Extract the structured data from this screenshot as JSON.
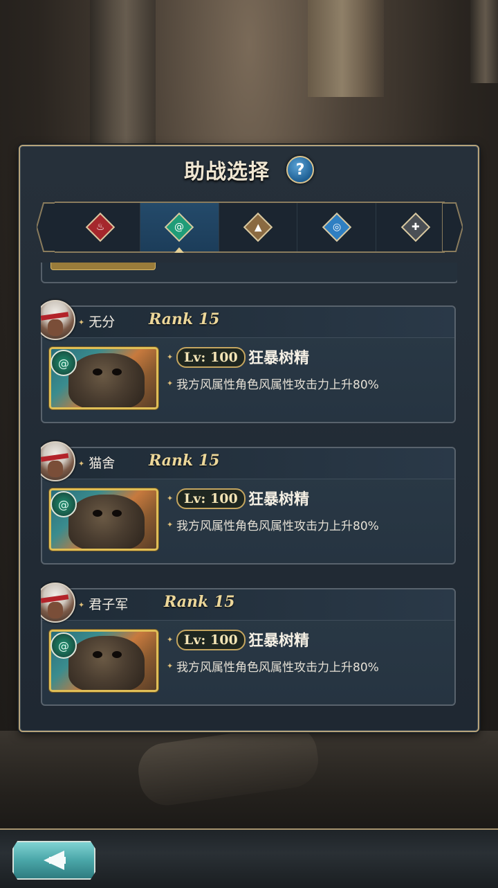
{
  "dialog": {
    "title": "助战选择",
    "help_label": "?"
  },
  "tabs": [
    {
      "icon": "fire-element-icon",
      "active": false
    },
    {
      "icon": "wind-element-icon",
      "active": true
    },
    {
      "icon": "earth-element-icon",
      "active": false
    },
    {
      "icon": "water-element-icon",
      "active": false
    },
    {
      "icon": "neutral-element-icon",
      "active": false
    }
  ],
  "supporters": [
    {
      "name": "无分",
      "rank": "Rank 15",
      "level": "Lv: 100",
      "monster": "狂暴树精",
      "effect": "我方风属性角色风属性攻击力上升80%"
    },
    {
      "name": "猫舍",
      "rank": "Rank 15",
      "level": "Lv: 100",
      "monster": "狂暴树精",
      "effect": "我方风属性角色风属性攻击力上升80%"
    },
    {
      "name": "君子军",
      "rank": "Rank 15",
      "level": "Lv: 100",
      "monster": "狂暴树精",
      "effect": "我方风属性角色风属性攻击力上升80%"
    }
  ],
  "colors": {
    "panel_border": "#b7a37a",
    "active_tab": "#244a6a",
    "rank_text": "#ecd79a"
  }
}
